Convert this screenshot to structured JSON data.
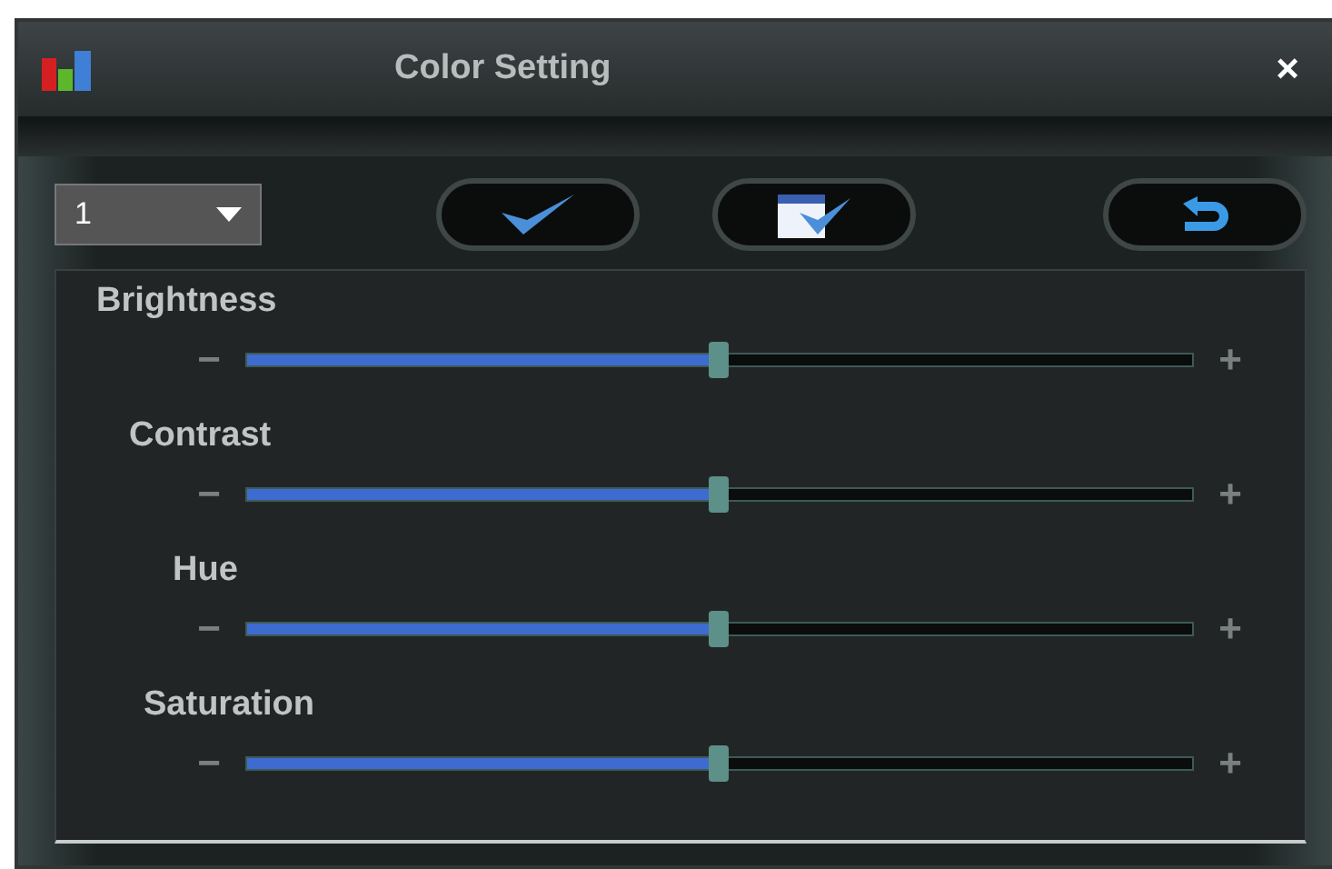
{
  "window": {
    "title": "Color Setting",
    "close": "×"
  },
  "channel_select": {
    "value": "1"
  },
  "sliders": [
    {
      "name": "Brightness",
      "minus": "−",
      "plus": "+",
      "level": 0.5
    },
    {
      "name": "Contrast",
      "minus": "−",
      "plus": "+",
      "level": 0.5
    },
    {
      "name": "Hue",
      "minus": "−",
      "plus": "+",
      "level": 0.5
    },
    {
      "name": "Saturation",
      "minus": "−",
      "plus": "+",
      "level": 0.5
    }
  ]
}
